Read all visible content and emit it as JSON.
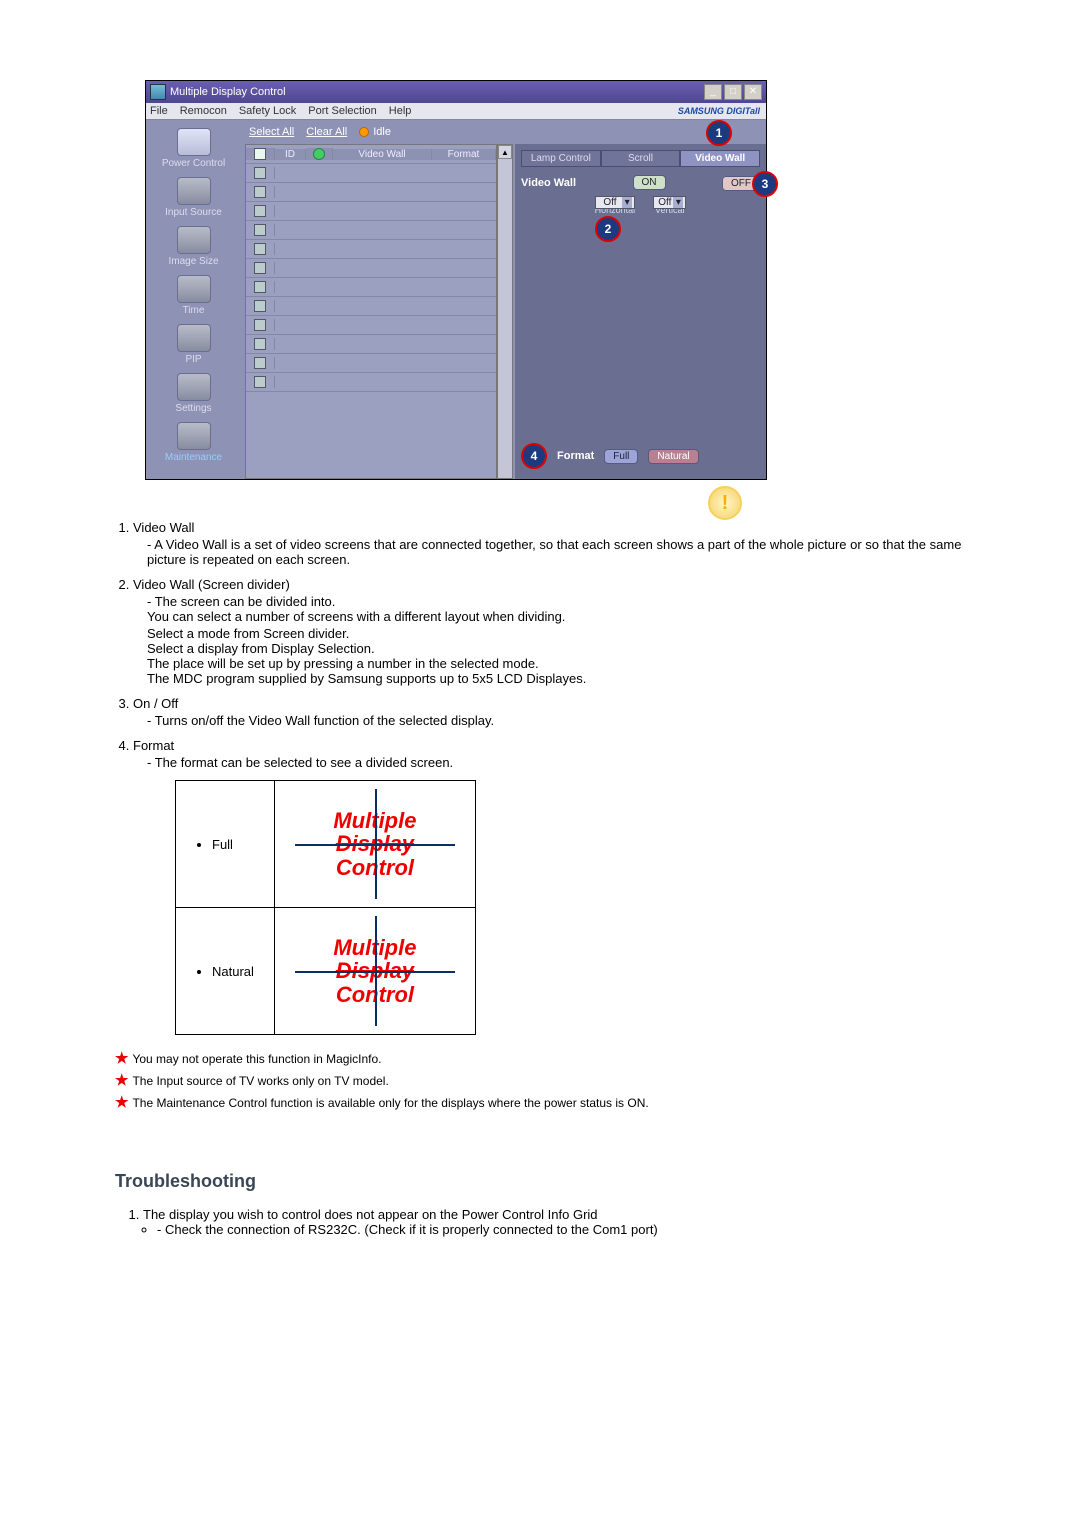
{
  "app": {
    "title": "Multiple Display Control",
    "menu": [
      "File",
      "Remocon",
      "Safety Lock",
      "Port Selection",
      "Help"
    ],
    "brand": "SAMSUNG DIGITall",
    "sidebar": [
      {
        "label": "Power Control",
        "active": false
      },
      {
        "label": "Input Source",
        "active": false
      },
      {
        "label": "Image Size",
        "active": false
      },
      {
        "label": "Time",
        "active": false
      },
      {
        "label": "PIP",
        "active": false
      },
      {
        "label": "Settings",
        "active": false
      },
      {
        "label": "Maintenance",
        "active": true
      }
    ],
    "actions": {
      "select_all": "Select All",
      "clear_all": "Clear All",
      "status_label": "Idle"
    },
    "grid": {
      "headers": {
        "id": "ID",
        "video_wall": "Video Wall",
        "format": "Format"
      },
      "row_count": 12
    },
    "panel": {
      "tabs": {
        "lamp": "Lamp Control",
        "scroll": "Scroll",
        "video": "Video Wall"
      },
      "vw_label": "Video Wall",
      "on": "ON",
      "off": "OFF",
      "dd_h": "Off",
      "dd_v": "Off",
      "dd_h_label": "Horizontal",
      "dd_v_label": "Vertical",
      "format_label": "Format",
      "fmt_full": "Full",
      "fmt_natural": "Natural"
    },
    "markers": {
      "m1": "1",
      "m2": "2",
      "m3": "3",
      "m4": "4"
    }
  },
  "notes": {
    "n1": {
      "title": "Video Wall",
      "l1": "A Video Wall is a set of video screens that are connected together, so that each screen shows a part of the whole picture or so that the same picture is repeated on each screen."
    },
    "n2": {
      "title": "Video Wall (Screen divider)",
      "l1": "The screen can be divided into.",
      "l2": "You can select a number of screens with a different layout when dividing.",
      "b1": "Select a mode from Screen divider.",
      "b2": "Select a display from Display Selection.",
      "b3": "The place will be set up by pressing a number in the selected mode.",
      "b4": "The MDC program supplied by Samsung supports up to 5x5 LCD Displayes."
    },
    "n3": {
      "title": "On / Off",
      "l1": "Turns on/off the Video Wall function of the selected display."
    },
    "n4": {
      "title": "Format",
      "l1": "The format can be selected to see a divided screen."
    }
  },
  "split": {
    "full": "Full",
    "natural": "Natural",
    "box_lines": {
      "l1": "Multiple",
      "l2": "Display",
      "l3": "Control"
    }
  },
  "stars": {
    "s1": "You may not operate this function in MagicInfo.",
    "s2": "The Input source of TV works only on TV model.",
    "s3": "The Maintenance Control function is available only for the displays where the power status is ON."
  },
  "section_title": "Troubleshooting",
  "trouble": {
    "l1": "The display you wish to control does not appear on the Power Control Info Grid",
    "l2": "Check the connection of RS232C. (Check if it is properly connected to the Com1 port)"
  }
}
